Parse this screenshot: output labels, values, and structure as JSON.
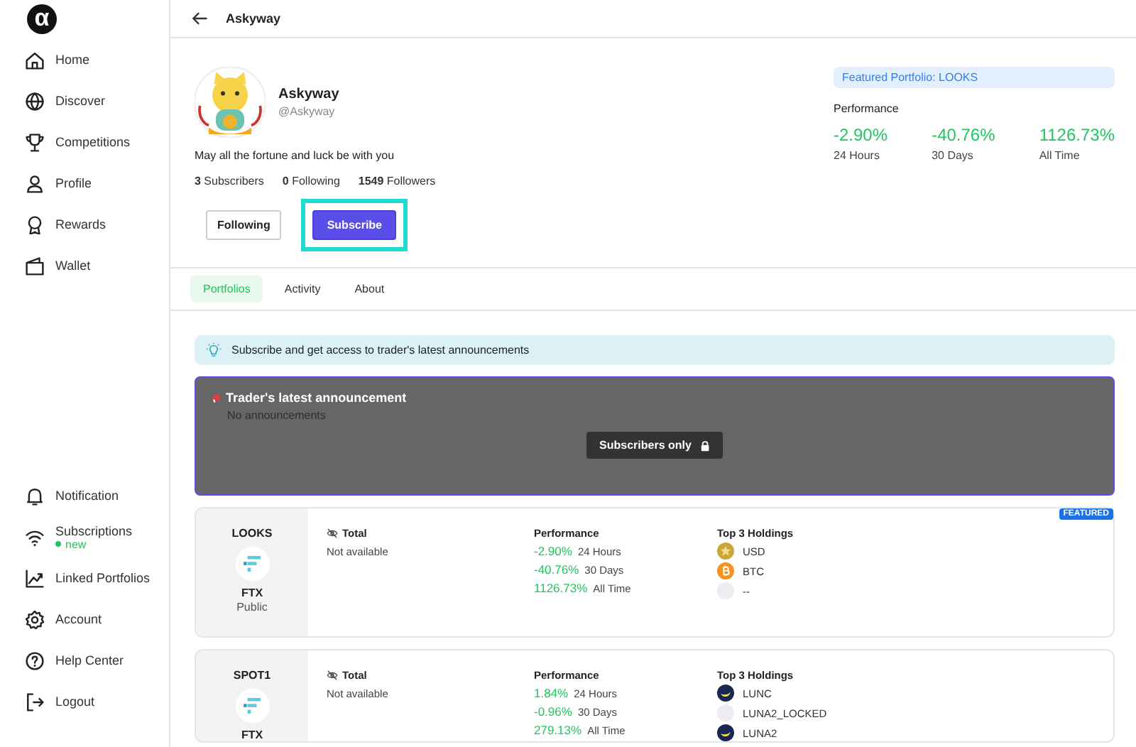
{
  "sidebar": {
    "logo": "α",
    "top_items": [
      {
        "label": "Home",
        "kind": "home"
      },
      {
        "label": "Discover",
        "kind": "globe"
      },
      {
        "label": "Competitions",
        "kind": "trophy"
      },
      {
        "label": "Profile",
        "kind": "person"
      },
      {
        "label": "Rewards",
        "kind": "award"
      },
      {
        "label": "Wallet",
        "kind": "wallet"
      }
    ],
    "bottom_items": [
      {
        "label": "Notification",
        "kind": "bell"
      },
      {
        "label": "Subscriptions",
        "kind": "wifi",
        "badge": "new"
      },
      {
        "label": "Linked Portfolios",
        "kind": "chart"
      },
      {
        "label": "Account",
        "kind": "gear"
      },
      {
        "label": "Help Center",
        "kind": "help"
      },
      {
        "label": "Logout",
        "kind": "logout"
      }
    ]
  },
  "header": {
    "title": "Askyway"
  },
  "profile": {
    "name": "Askyway",
    "handle": "@Askyway",
    "bio": "May all the fortune and luck be with you",
    "stats": [
      {
        "count": "3",
        "label": "Subscribers"
      },
      {
        "count": "0",
        "label": "Following"
      },
      {
        "count": "1549",
        "label": "Followers"
      }
    ],
    "buttons": [
      {
        "label": "Following",
        "kind": "outline",
        "highlighted": false
      },
      {
        "label": "Subscribe",
        "kind": "primary",
        "highlighted": true
      }
    ]
  },
  "featured": {
    "label": "Featured Portfolio: LOOKS",
    "performance_label": "Performance",
    "metrics": [
      {
        "value": "-2.90%",
        "label": "24 Hours"
      },
      {
        "value": "-40.76%",
        "label": "30 Days"
      },
      {
        "value": "1126.73%",
        "label": "All Time"
      }
    ]
  },
  "tabs": [
    {
      "label": "Portfolios",
      "selected": true
    },
    {
      "label": "Activity",
      "selected": false
    },
    {
      "label": "About",
      "selected": false
    }
  ],
  "notice": "Subscribe and get access to trader's latest announcements",
  "announcement": {
    "title": "Trader's latest announcement",
    "empty_text": "No announcements",
    "locked_label": "Subscribers only"
  },
  "portfolios": [
    {
      "name": "LOOKS",
      "exchange": "FTX",
      "visibility": "Public",
      "badge": "FEATURED",
      "total_label": "Total",
      "total_value": "Not available",
      "performance_label": "Performance",
      "performance": [
        {
          "value": "-2.90%",
          "period": "24 Hours"
        },
        {
          "value": "-40.76%",
          "period": "30 Days"
        },
        {
          "value": "1126.73%",
          "period": "All Time"
        }
      ],
      "holdings_label": "Top 3 Holdings",
      "holdings": [
        {
          "symbol": "USD",
          "kind": "usd"
        },
        {
          "symbol": "BTC",
          "kind": "btc"
        },
        {
          "symbol": "--",
          "kind": "blank"
        }
      ]
    },
    {
      "name": "SPOT1",
      "exchange": "FTX",
      "total_label": "Total",
      "total_value": "Not available",
      "performance_label": "Performance",
      "performance": [
        {
          "value": "1.84%",
          "period": "24 Hours"
        },
        {
          "value": "-0.96%",
          "period": "30 Days"
        },
        {
          "value": "279.13%",
          "period": "All Time"
        }
      ],
      "holdings_label": "Top 3 Holdings",
      "holdings": [
        {
          "symbol": "LUNC",
          "kind": "luna"
        },
        {
          "symbol": "LUNA2_LOCKED",
          "kind": "blank"
        },
        {
          "symbol": "LUNA2",
          "kind": "luna"
        }
      ]
    }
  ]
}
